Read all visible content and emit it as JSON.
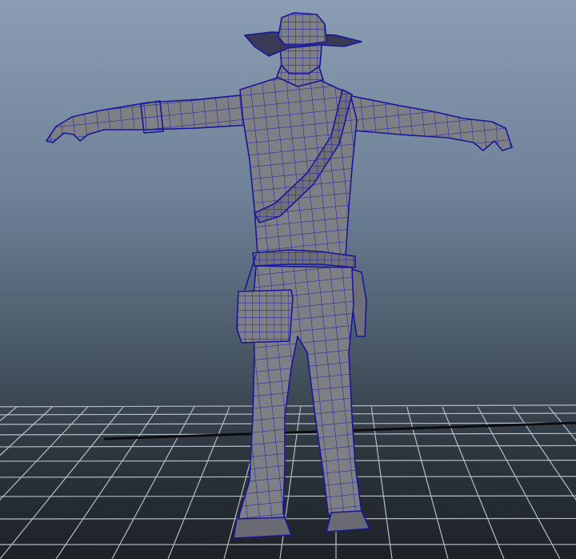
{
  "viewport": {
    "background_top": "#8a9db3",
    "background_bottom": "#1c2126",
    "grid_color": "#b4bcc4",
    "grid_axis_color": "#0c0c0c"
  },
  "model": {
    "shading_color": "#7f7f86",
    "wireframe_color": "#1c1ca8"
  }
}
